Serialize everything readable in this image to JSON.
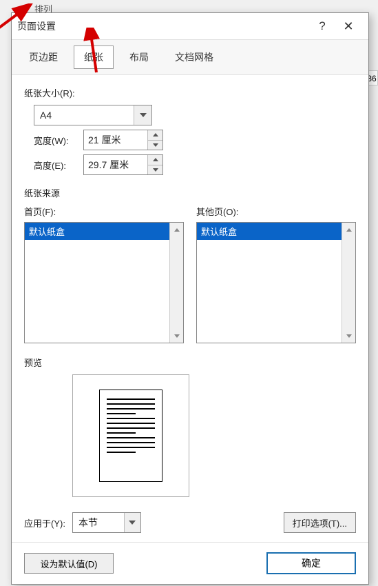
{
  "bg_label": "排列",
  "side_badge": "36",
  "dialog": {
    "title": "页面设置",
    "tabs": [
      "页边距",
      "纸张",
      "布局",
      "文档网格"
    ],
    "active_tab_index": 1,
    "paper_size_label": "纸张大小(R):",
    "paper_size_value": "A4",
    "width_label": "宽度(W):",
    "width_value": "21 厘米",
    "height_label": "高度(E):",
    "height_value": "29.7 厘米",
    "source_heading": "纸张来源",
    "first_page_label": "首页(F):",
    "first_page_items": [
      "默认纸盒"
    ],
    "other_pages_label": "其他页(O):",
    "other_pages_items": [
      "默认纸盒"
    ],
    "preview_heading": "预览",
    "apply_to_label": "应用于(Y):",
    "apply_to_value": "本节",
    "print_options_label": "打印选项(T)...",
    "set_default_label": "设为默认值(D)",
    "ok_label": "确定"
  }
}
